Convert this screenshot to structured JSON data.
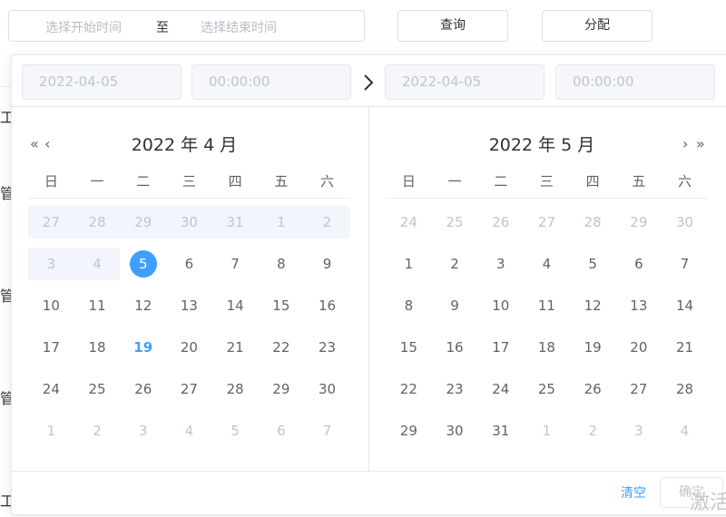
{
  "search": {
    "start_placeholder": "选择开始时间",
    "separator": "至",
    "end_placeholder": "选择结束时间"
  },
  "toolbar": {
    "query_label": "查询",
    "assign_label": "分配"
  },
  "background": {
    "fragments": [
      "工",
      "管",
      "管",
      "管",
      "工"
    ]
  },
  "picker": {
    "start_date": "2022-04-05",
    "start_time": "00:00:00",
    "end_date": "2022-04-05",
    "end_time": "00:00:00",
    "weekdays": [
      "日",
      "一",
      "二",
      "三",
      "四",
      "五",
      "六"
    ],
    "left": {
      "title": "2022 年 4 月",
      "prev_year_icon": "«",
      "prev_month_icon": "‹",
      "days": [
        [
          "27",
          "28",
          "29",
          "30",
          "31",
          "1",
          "2"
        ],
        [
          "3",
          "4",
          "5",
          "6",
          "7",
          "8",
          "9"
        ],
        [
          "10",
          "11",
          "12",
          "13",
          "14",
          "15",
          "16"
        ],
        [
          "17",
          "18",
          "19",
          "20",
          "21",
          "22",
          "23"
        ],
        [
          "24",
          "25",
          "26",
          "27",
          "28",
          "29",
          "30"
        ],
        [
          "1",
          "2",
          "3",
          "4",
          "5",
          "6",
          "7"
        ]
      ]
    },
    "right": {
      "title": "2022 年 5 月",
      "next_month_icon": "›",
      "next_year_icon": "»",
      "days": [
        [
          "24",
          "25",
          "26",
          "27",
          "28",
          "29",
          "30"
        ],
        [
          "1",
          "2",
          "3",
          "4",
          "5",
          "6",
          "7"
        ],
        [
          "8",
          "9",
          "10",
          "11",
          "12",
          "13",
          "14"
        ],
        [
          "15",
          "16",
          "17",
          "18",
          "19",
          "20",
          "21"
        ],
        [
          "22",
          "23",
          "24",
          "25",
          "26",
          "27",
          "28"
        ],
        [
          "29",
          "30",
          "31",
          "1",
          "2",
          "3",
          "4"
        ]
      ]
    },
    "clear_label": "清空",
    "confirm_label": "确定"
  },
  "watermark": "激活",
  "colors": {
    "accent": "#409eff",
    "range_bg": "#f2f6fc",
    "muted": "#c0c4cc"
  }
}
